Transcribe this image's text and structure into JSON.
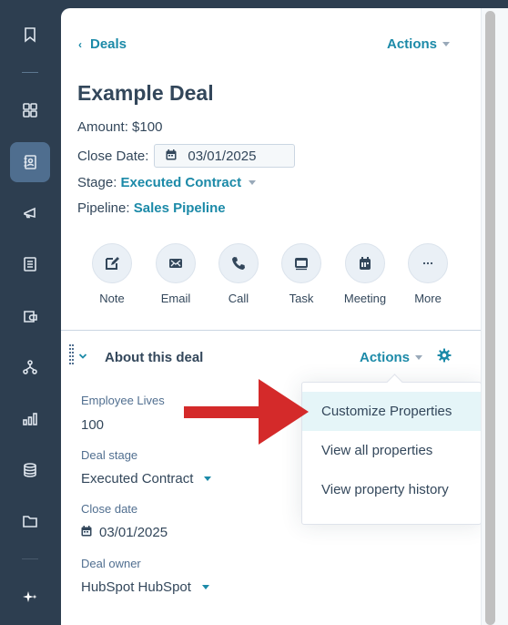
{
  "sidebar": {
    "items": [
      {
        "icon": "bookmark-icon",
        "label": "Bookmarks",
        "active": false
      },
      {
        "icon": "grid-icon",
        "label": "Workspaces",
        "active": false
      },
      {
        "icon": "contacts-book-icon",
        "label": "CRM",
        "active": true
      },
      {
        "icon": "megaphone-icon",
        "label": "Marketing",
        "active": false
      },
      {
        "icon": "content-icon",
        "label": "Content",
        "active": false
      },
      {
        "icon": "commerce-icon",
        "label": "Commerce",
        "active": false
      },
      {
        "icon": "automation-icon",
        "label": "Automations",
        "active": false
      },
      {
        "icon": "reporting-icon",
        "label": "Reporting",
        "active": false
      },
      {
        "icon": "data-management-icon",
        "label": "Data Management",
        "active": false
      },
      {
        "icon": "library-folder-icon",
        "label": "Library",
        "active": false
      },
      {
        "icon": "ai-sparkle-icon",
        "label": "AI",
        "active": false
      }
    ]
  },
  "header": {
    "back_label": "Deals",
    "actions_label": "Actions"
  },
  "record": {
    "title": "Example Deal",
    "amount_label": "Amount:",
    "amount_value": "$100",
    "close_date_label": "Close Date:",
    "close_date_value": "03/01/2025",
    "stage_label": "Stage:",
    "stage_value": "Executed Contract",
    "pipeline_label": "Pipeline:",
    "pipeline_value": "Sales Pipeline"
  },
  "activities": [
    {
      "label": "Note",
      "icon": "note-edit-icon"
    },
    {
      "label": "Email",
      "icon": "email-icon"
    },
    {
      "label": "Call",
      "icon": "phone-icon"
    },
    {
      "label": "Task",
      "icon": "task-icon"
    },
    {
      "label": "Meeting",
      "icon": "meeting-calendar-icon"
    },
    {
      "label": "More",
      "icon": "more-ellipsis-icon"
    }
  ],
  "about_section": {
    "title": "About this deal",
    "actions_label": "Actions",
    "fields": [
      {
        "label": "Employee Lives",
        "value": "100"
      },
      {
        "label": "Deal stage",
        "value": "Executed Contract"
      },
      {
        "label": "Close date",
        "value": "03/01/2025"
      },
      {
        "label": "Deal owner",
        "value": "HubSpot HubSpot"
      }
    ]
  },
  "actions_menu": {
    "items": [
      {
        "label": "Customize Properties",
        "highlighted": true
      },
      {
        "label": "View all properties",
        "highlighted": false
      },
      {
        "label": "View property history",
        "highlighted": false
      }
    ]
  },
  "colors": {
    "sidebar_bg": "#2d3e50",
    "accent": "#1c8aa8",
    "text": "#33475b",
    "highlight": "#e5f5f8",
    "annotation_arrow": "#d42a2a"
  }
}
